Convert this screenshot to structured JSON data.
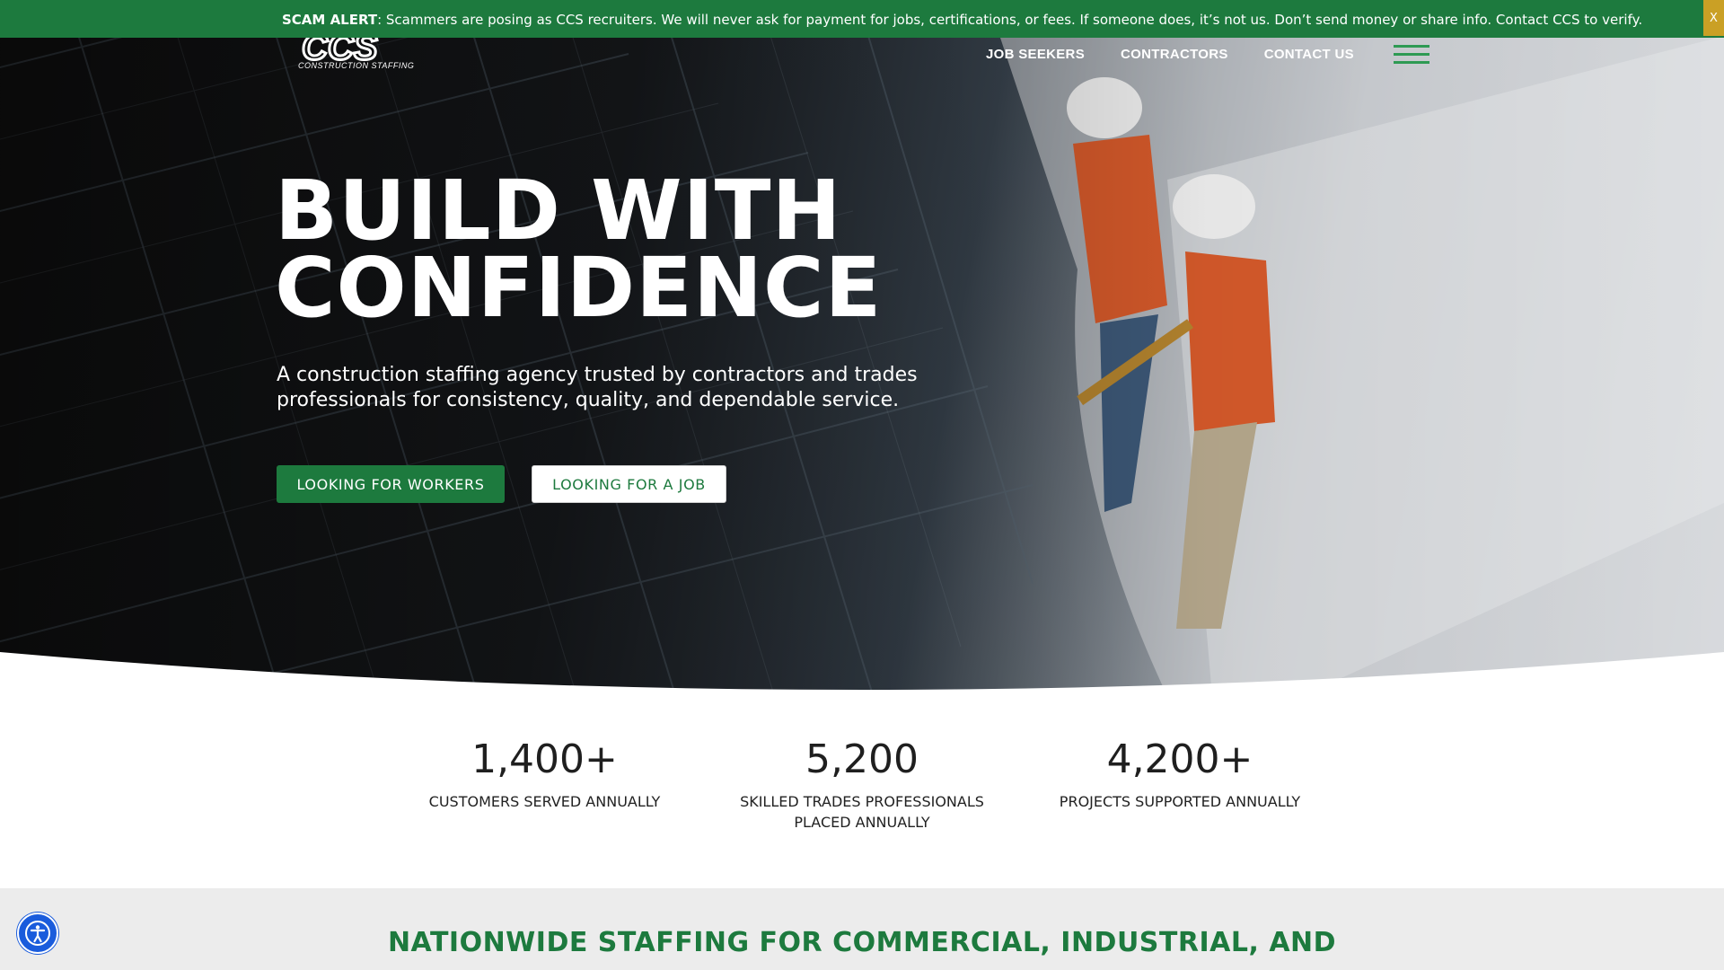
{
  "alert": {
    "label": "SCAM ALERT",
    "message": ": Scammers are posing as CCS recruiters. We will never ask for payment for jobs, certifications, or fees. If someone does, it’s not us. Don’t send money or share info. Contact CCS to verify.",
    "close": "X"
  },
  "header": {
    "logo_text": "CCS",
    "logo_sub": "CONSTRUCTION STAFFING",
    "nav": [
      "JOB SEEKERS",
      "CONTRACTORS",
      "CONTACT US"
    ],
    "menu_icon": "hamburger-icon"
  },
  "hero": {
    "title_line1": "BUILD WITH",
    "title_line2": "CONFIDENCE",
    "subtitle": "A construction staffing agency trusted by contractors and trades professionals for consistency, quality, and dependable service.",
    "btn_workers": "LOOKING FOR WORKERS",
    "btn_job": "LOOKING FOR A JOB"
  },
  "stats": [
    {
      "number": "1,400+",
      "label": "CUSTOMERS SERVED ANNUALLY"
    },
    {
      "number": "5,200",
      "label": "SKILLED TRADES PROFESSIONALS PLACED ANNUALLY"
    },
    {
      "number": "4,200+",
      "label": "PROJECTS SUPPORTED ANNUALLY"
    }
  ],
  "section": {
    "title": "NATIONWIDE STAFFING FOR COMMERCIAL, INDUSTRIAL, AND"
  },
  "colors": {
    "brand_green": "#1d7a3e",
    "alert_close": "#caa025",
    "accessibility_blue": "#1a5cdc"
  },
  "accessibility": {
    "icon": "accessibility-icon"
  }
}
